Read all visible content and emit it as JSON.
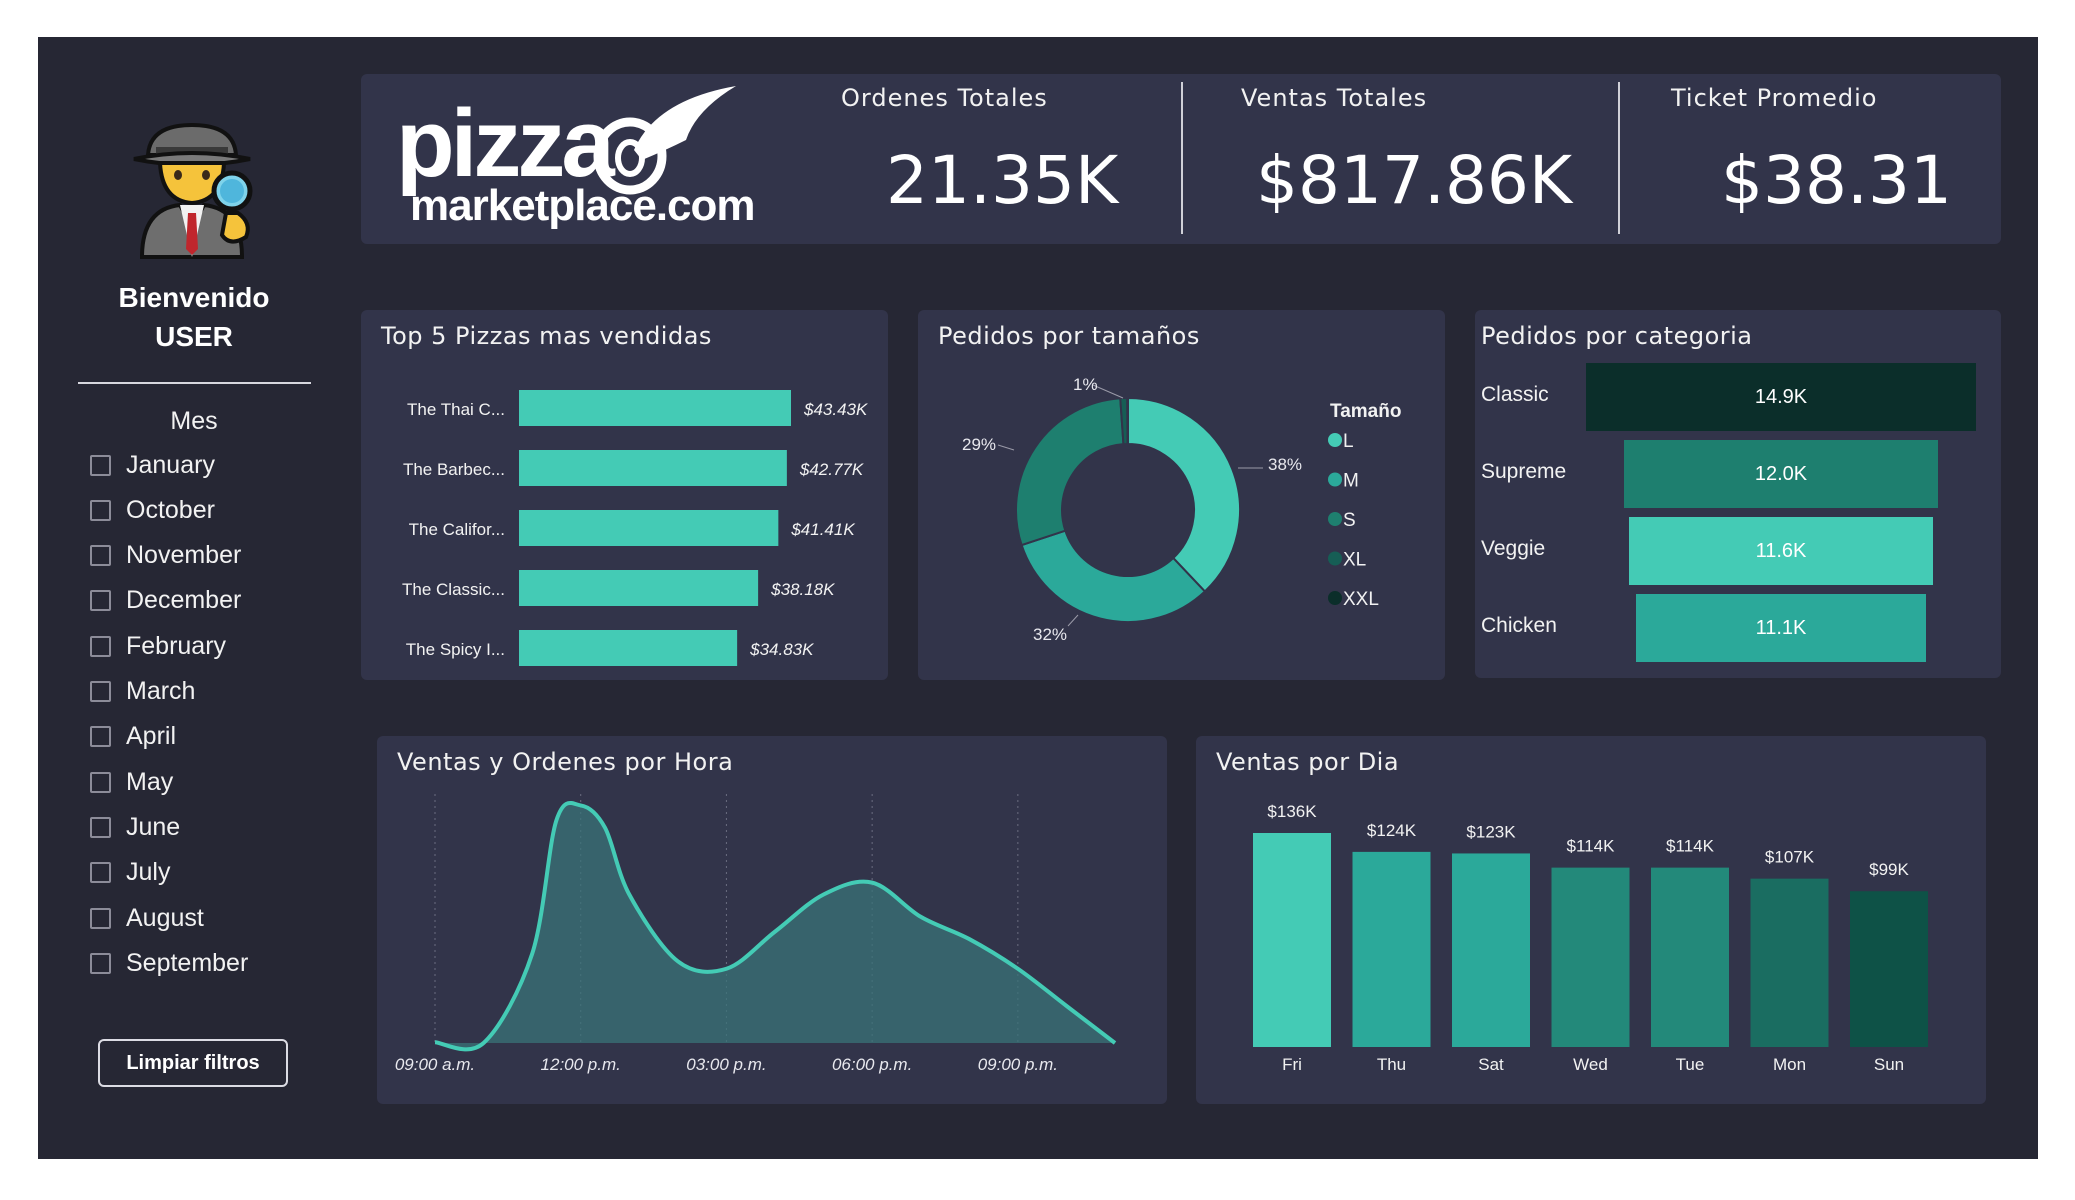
{
  "sidebar": {
    "welcome_line1": "Bienvenido",
    "welcome_line2": "USER",
    "filter_title": "Mes",
    "months": [
      "January",
      "October",
      "November",
      "December",
      "February",
      "March",
      "April",
      "May",
      "June",
      "July",
      "August",
      "September"
    ],
    "clear_button": "Limpiar filtros",
    "avatar_icon": "detective-icon"
  },
  "header": {
    "logo_text_1": "pizza",
    "logo_text_2": "marketplace.com",
    "kpis": [
      {
        "label": "Ordenes Totales",
        "value": "21.35K"
      },
      {
        "label": "Ventas Totales",
        "value": "$817.86K"
      },
      {
        "label": "Ticket Promedio",
        "value": "$38.31"
      }
    ]
  },
  "colors": {
    "background": "#262734",
    "panel": "#32344a",
    "accent": "#44cbb5",
    "teal_mid": "#2ba99a",
    "teal_dark": "#1e7f6f",
    "teal_darkest": "#0b2e2a"
  },
  "top_pizzas": {
    "title": "Top 5 Pizzas mas vendidas",
    "items": [
      {
        "name": "The Thai C...",
        "label": "$43.43K"
      },
      {
        "name": "The Barbec...",
        "label": "$42.77K"
      },
      {
        "name": "The Califor...",
        "label": "$41.41K"
      },
      {
        "name": "The Classic...",
        "label": "$38.18K"
      },
      {
        "name": "The Spicy I...",
        "label": "$34.83K"
      }
    ]
  },
  "sizes": {
    "title": "Pedidos por tamaños",
    "legend_title": "Tamaño",
    "legend": [
      "L",
      "M",
      "S",
      "XL",
      "XXL"
    ],
    "labels": [
      "38%",
      "32%",
      "29%",
      "1%"
    ]
  },
  "categories": {
    "title": "Pedidos por categoria",
    "items": [
      {
        "name": "Classic",
        "value": "14.9K"
      },
      {
        "name": "Supreme",
        "value": "12.0K"
      },
      {
        "name": "Veggie",
        "value": "11.6K"
      },
      {
        "name": "Chicken",
        "value": "11.1K"
      }
    ]
  },
  "hourly": {
    "title": "Ventas y Ordenes por Hora",
    "x_ticks": [
      "09:00 a.m.",
      "12:00 p.m.",
      "03:00 p.m.",
      "06:00 p.m.",
      "09:00 p.m."
    ]
  },
  "daily": {
    "title": "Ventas por Dia"
  },
  "chart_data": [
    {
      "type": "bar",
      "title": "Top 5 Pizzas mas vendidas",
      "orientation": "horizontal",
      "categories": [
        "The Thai C...",
        "The Barbec...",
        "The Califor...",
        "The Classic...",
        "The Spicy I..."
      ],
      "values": [
        43.43,
        42.77,
        41.41,
        38.18,
        34.83
      ],
      "unit": "K$"
    },
    {
      "type": "pie",
      "subtype": "donut",
      "title": "Pedidos por tamaños",
      "categories": [
        "L",
        "M",
        "S",
        "XL",
        "XXL"
      ],
      "values": [
        38,
        32,
        29,
        1,
        0.1
      ],
      "colors": [
        "#44cbb5",
        "#2ba99a",
        "#1e7f6f",
        "#165e55",
        "#0b2e2a"
      ]
    },
    {
      "type": "bar",
      "subtype": "funnel",
      "title": "Pedidos por categoria",
      "categories": [
        "Classic",
        "Supreme",
        "Veggie",
        "Chicken"
      ],
      "values": [
        14.9,
        12.0,
        11.6,
        11.1
      ],
      "colors": [
        "#0b2e2a",
        "#1e7f6f",
        "#44cbb5",
        "#2ba99a"
      ]
    },
    {
      "type": "area",
      "title": "Ventas y Ordenes por Hora",
      "x": [
        9,
        10,
        11,
        11.5,
        12,
        12.5,
        13,
        14,
        15,
        16,
        17,
        18,
        19,
        20,
        21,
        22,
        23
      ],
      "y": [
        0.5,
        0,
        60,
        150,
        160,
        145,
        100,
        55,
        50,
        75,
        100,
        108,
        85,
        70,
        50,
        25,
        0
      ],
      "x_ticks": [
        "09:00 a.m.",
        "12:00 p.m.",
        "03:00 p.m.",
        "06:00 p.m.",
        "09:00 p.m."
      ],
      "grid": "vertical dotted"
    },
    {
      "type": "bar",
      "title": "Ventas por Dia",
      "categories": [
        "Fri",
        "Thu",
        "Sat",
        "Wed",
        "Tue",
        "Mon",
        "Sun"
      ],
      "values": [
        136,
        124,
        123,
        114,
        114,
        107,
        99
      ],
      "labels": [
        "$136K",
        "$124K",
        "$123K",
        "$114K",
        "$114K",
        "$107K",
        "$99K"
      ],
      "colors": [
        "#44cbb5",
        "#2ba99a",
        "#2ba99a",
        "#23897a",
        "#23897a",
        "#1a6d61",
        "#0e5247"
      ]
    }
  ]
}
